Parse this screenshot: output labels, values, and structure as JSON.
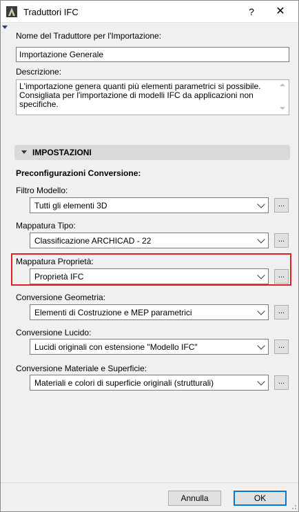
{
  "window": {
    "title": "Traduttori IFC",
    "help_label": "?",
    "close_label": "✕"
  },
  "name_field": {
    "label": "Nome del Traduttore per l'Importazione:",
    "value": "Importazione Generale"
  },
  "description": {
    "label": "Descrizione:",
    "value": "L'importazione genera quanti più elementi parametrici si possibile. Consigliata per l'importazione di modelli IFC da applicazioni non specifiche."
  },
  "settings": {
    "header": "IMPOSTAZIONI",
    "subheading": "Preconfigurazioni Conversione:",
    "rows": [
      {
        "label": "Filtro Modello:",
        "value": "Tutti gli elementi 3D",
        "button": "..."
      },
      {
        "label": "Mappatura Tipo:",
        "value": "Classificazione ARCHICAD - 22",
        "button": "..."
      },
      {
        "label": "Mappatura Proprietà:",
        "value": "Proprietà IFC",
        "button": "..."
      },
      {
        "label": "Conversione Geometria:",
        "value": "Elementi di Costruzione e MEP parametrici",
        "button": "..."
      },
      {
        "label": "Conversione Lucido:",
        "value": "Lucidi originali con estensione \"Modello IFC\"",
        "button": "..."
      },
      {
        "label": "Conversione Materiale e Superficie:",
        "value": "Materiali e colori di superficie originali (strutturali)",
        "button": "..."
      }
    ]
  },
  "footer": {
    "cancel_label": "Annulla",
    "ok_label": "OK"
  },
  "colors": {
    "highlight": "#e02020",
    "ok_border": "#0078d7"
  },
  "icons": [
    "archicad-logo-icon",
    "chevron-down-icon",
    "collapse-triangle-icon",
    "resize-grip-icon"
  ]
}
